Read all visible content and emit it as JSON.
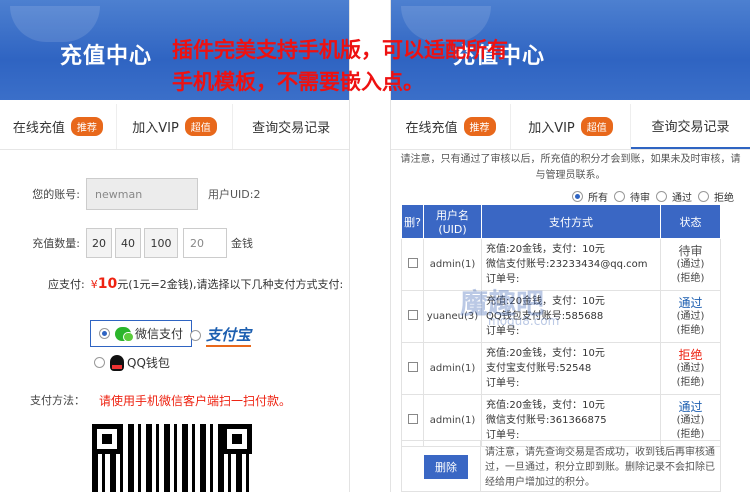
{
  "overlay": {
    "line1": "插件完美支持手机版，可以适配所有",
    "line2": "手机模板，不需要嵌入点。"
  },
  "left": {
    "banner_title": "充值中心",
    "tabs": [
      {
        "label": "在线充值",
        "badge": "推荐"
      },
      {
        "label": "加入VIP",
        "badge": "超值"
      },
      {
        "label": "查询交易记录"
      }
    ],
    "account_label": "您的账号:",
    "account_value": "newman",
    "uid_text": "用户UID:2",
    "amount_label": "充值数量:",
    "amount_options": [
      "20",
      "40",
      "100"
    ],
    "amount_input": "20",
    "amount_unit": "金钱",
    "pay_label": "应支付:",
    "pay_currency": "¥",
    "pay_amount": "10",
    "pay_note": "元(1元=2金钱),请选择以下几种支付方式支付:",
    "pay_options": {
      "wechat": "微信支付",
      "alipay": "支付宝",
      "qq": "QQ钱包"
    },
    "method_label": "支付方法：",
    "method_text": "请使用手机微信客户端扫一扫付款。"
  },
  "right": {
    "banner_title": "充值中心",
    "tabs": [
      {
        "label": "在线充值",
        "badge": "推荐"
      },
      {
        "label": "加入VIP",
        "badge": "超值"
      },
      {
        "label": "查询交易记录"
      }
    ],
    "notice": "请注意，只有通过了审核以后，所充值的积分才会到账，如果未及时审核，请与管理员联系。",
    "filters": [
      "所有",
      "待审",
      "通过",
      "拒绝"
    ],
    "table": {
      "headers": [
        "删?",
        "用户名(UID)",
        "支付方式",
        "状态"
      ],
      "rows": [
        {
          "user": "admin(1)",
          "line1": "充值:20金钱，支付：10元",
          "line2": "微信支付账号:23233434@qq.com",
          "line3": "订单号:",
          "status": "待审",
          "status_color": "gray",
          "sub1": "(通过)",
          "sub2": "(拒绝)"
        },
        {
          "user": "yuaneu(3)",
          "line1": "充值:20金钱，支付：10元",
          "line2": "QQ钱包支付账号:585688",
          "line3": "订单号:",
          "status": "通过",
          "status_color": "blue",
          "sub1": "(通过)",
          "sub2": "(拒绝)"
        },
        {
          "user": "admin(1)",
          "line1": "充值:20金钱，支付：10元",
          "line2": "支付宝支付账号:52548",
          "line3": "订单号:",
          "status": "拒绝",
          "status_color": "red",
          "sub1": "(通过)",
          "sub2": "(拒绝)"
        },
        {
          "user": "admin(1)",
          "line1": "充值:20金钱，支付：10元",
          "line2": "微信支付账号:361366875",
          "line3": "订单号:",
          "status": "通过",
          "status_color": "blue",
          "sub1": "(通过)",
          "sub2": "(拒绝)"
        }
      ]
    },
    "delete_label": "删除",
    "footer_note": "请注意，请先查询交易是否成功，收到钱后再审核通过，一旦通过，积分立即到账。删除记录不会扣除已经给用户增加过的积分。"
  },
  "watermark": {
    "text": "魔趣吧",
    "url": "moqu8.com"
  },
  "colors": {
    "primary": "#2f64c2",
    "badge": "#e8681b",
    "alert": "#e21111"
  }
}
